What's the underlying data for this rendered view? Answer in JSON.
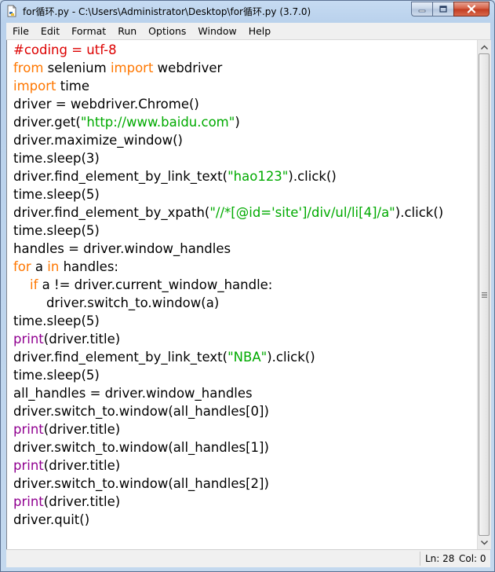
{
  "window": {
    "title": "for循环.py - C:\\Users\\Administrator\\Desktop\\for循环.py (3.7.0)"
  },
  "menu": [
    "File",
    "Edit",
    "Format",
    "Run",
    "Options",
    "Window",
    "Help"
  ],
  "code_lines": [
    [
      {
        "t": "#coding = utf-8",
        "c": "cm"
      }
    ],
    [
      {
        "t": "from",
        "c": "kw"
      },
      {
        "t": " selenium "
      },
      {
        "t": "import",
        "c": "kw"
      },
      {
        "t": " webdriver"
      }
    ],
    [
      {
        "t": "import",
        "c": "kw"
      },
      {
        "t": " time"
      }
    ],
    [
      {
        "t": "driver = webdriver.Chrome()"
      }
    ],
    [
      {
        "t": "driver.get("
      },
      {
        "t": "\"http://www.baidu.com\"",
        "c": "st"
      },
      {
        "t": ")"
      }
    ],
    [
      {
        "t": "driver.maximize_window()"
      }
    ],
    [
      {
        "t": "time.sleep(3)"
      }
    ],
    [
      {
        "t": "driver.find_element_by_link_text("
      },
      {
        "t": "\"hao123\"",
        "c": "st"
      },
      {
        "t": ").click()"
      }
    ],
    [
      {
        "t": "time.sleep(5)"
      }
    ],
    [
      {
        "t": "driver.find_element_by_xpath("
      },
      {
        "t": "\"//*[@id='site']/div/ul/li[4]/a\"",
        "c": "st"
      },
      {
        "t": ").click()"
      }
    ],
    [
      {
        "t": "time.sleep(5)"
      }
    ],
    [
      {
        "t": "handles = driver.window_handles"
      }
    ],
    [
      {
        "t": "for",
        "c": "kw"
      },
      {
        "t": " a "
      },
      {
        "t": "in",
        "c": "kw"
      },
      {
        "t": " handles:"
      }
    ],
    [
      {
        "t": "    "
      },
      {
        "t": "if",
        "c": "kw"
      },
      {
        "t": " a != driver.current_window_handle:"
      }
    ],
    [
      {
        "t": "        driver.switch_to.window(a)"
      }
    ],
    [
      {
        "t": "time.sleep(5)"
      }
    ],
    [
      {
        "t": "print",
        "c": "bi"
      },
      {
        "t": "(driver.title)"
      }
    ],
    [
      {
        "t": "driver.find_element_by_link_text("
      },
      {
        "t": "\"NBA\"",
        "c": "st"
      },
      {
        "t": ").click()"
      }
    ],
    [
      {
        "t": "time.sleep(5)"
      }
    ],
    [
      {
        "t": "all_handles = driver.window_handles"
      }
    ],
    [
      {
        "t": "driver.switch_to.window(all_handles[0])"
      }
    ],
    [
      {
        "t": "print",
        "c": "bi"
      },
      {
        "t": "(driver.title)"
      }
    ],
    [
      {
        "t": "driver.switch_to.window(all_handles[1])"
      }
    ],
    [
      {
        "t": "print",
        "c": "bi"
      },
      {
        "t": "(driver.title)"
      }
    ],
    [
      {
        "t": "driver.switch_to.window(all_handles[2])"
      }
    ],
    [
      {
        "t": "print",
        "c": "bi"
      },
      {
        "t": "(driver.title)"
      }
    ],
    [
      {
        "t": "driver.quit()"
      }
    ]
  ],
  "status": {
    "line": "Ln: 28",
    "col": "Col: 0"
  },
  "colors": {
    "keyword": "#ff7700",
    "comment": "#dd0000",
    "string": "#00aa00",
    "builtin": "#900090"
  },
  "icons": {
    "app": "idle-python-file-icon",
    "minimize": "minimize-icon",
    "maximize": "maximize-icon",
    "close": "close-icon"
  }
}
